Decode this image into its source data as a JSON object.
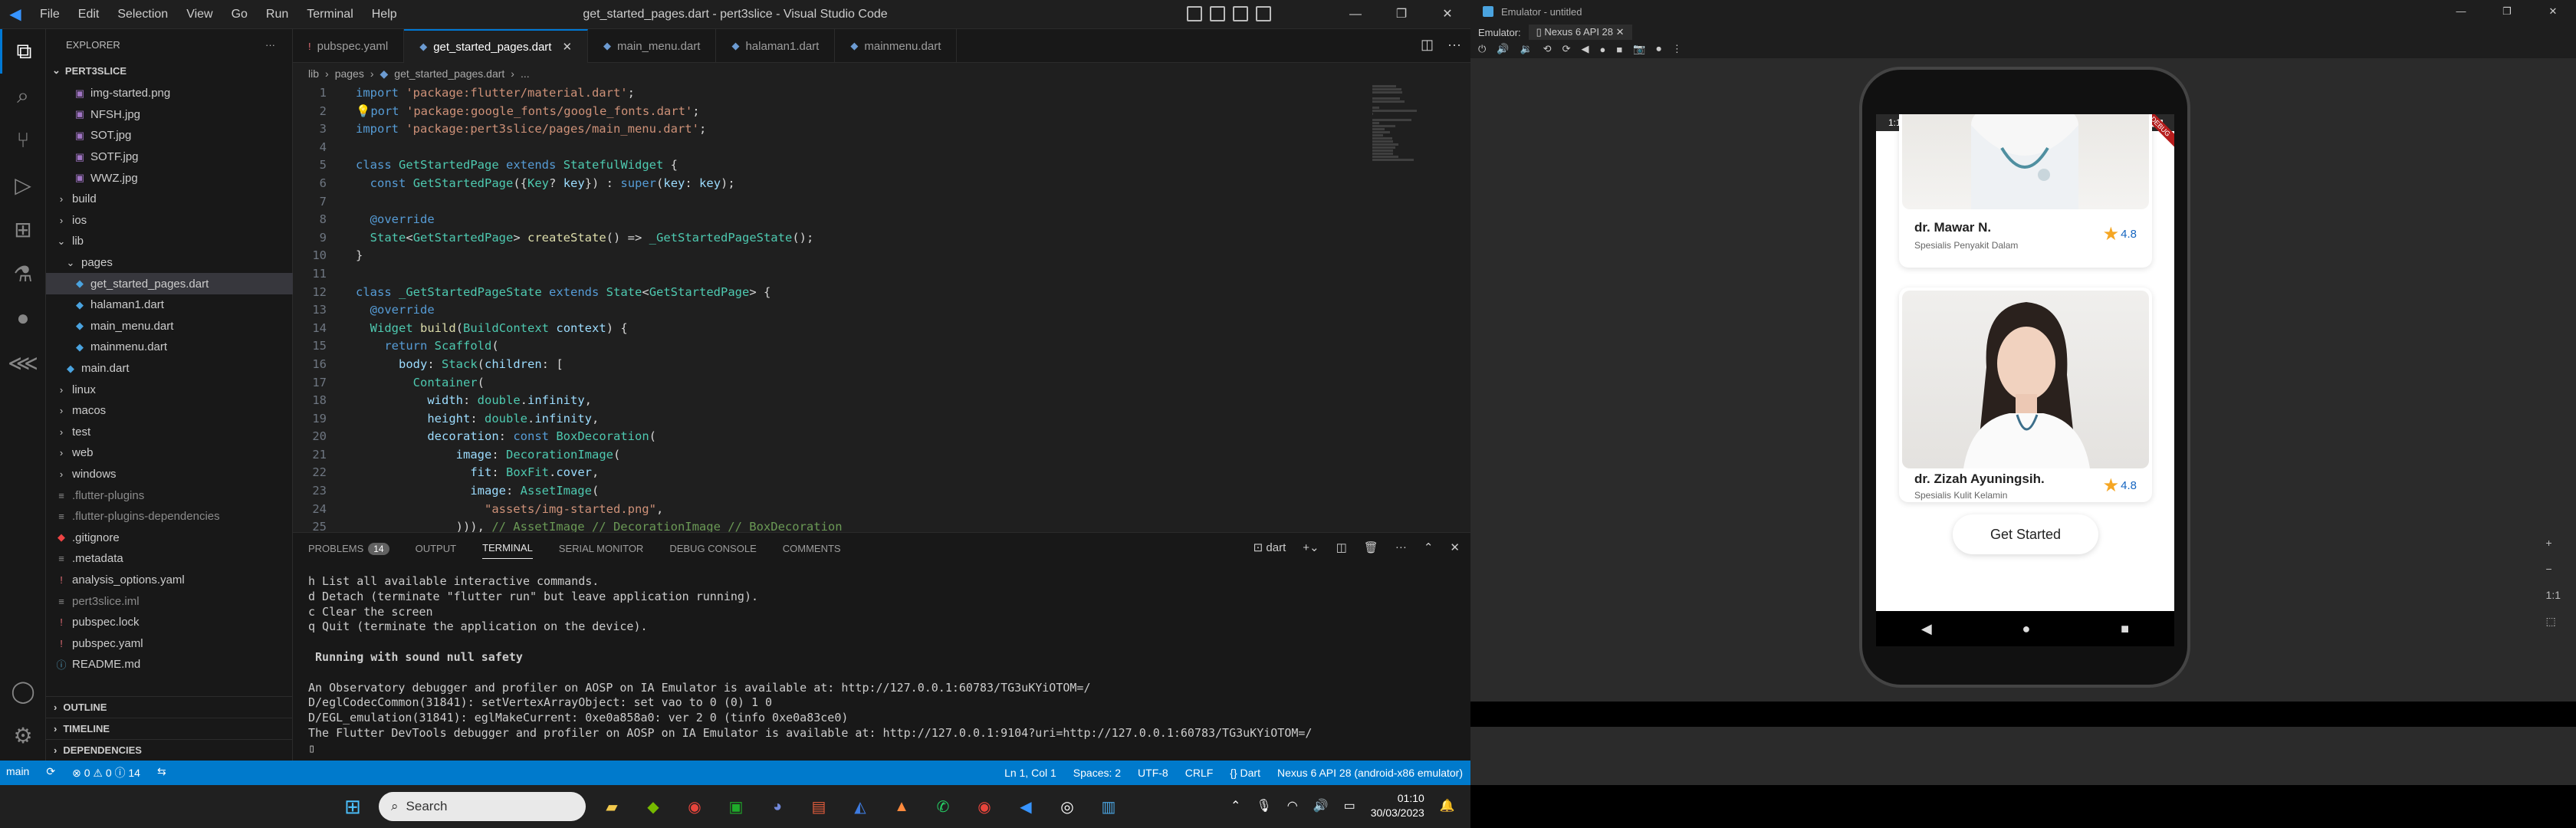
{
  "vscode": {
    "window_title": "get_started_pages.dart - pert3slice - Visual Studio Code",
    "menu": [
      "File",
      "Edit",
      "Selection",
      "View",
      "Go",
      "Run",
      "Terminal",
      "Help"
    ],
    "explorer_title": "EXPLORER",
    "project": "PERT3SLICE",
    "tree": [
      {
        "label": "img-started.png",
        "indent": 3,
        "icon": "image",
        "type": "file"
      },
      {
        "label": "NFSH.jpg",
        "indent": 3,
        "icon": "image",
        "type": "file"
      },
      {
        "label": "SOT.jpg",
        "indent": 3,
        "icon": "image",
        "type": "file"
      },
      {
        "label": "SOTF.jpg",
        "indent": 3,
        "icon": "image",
        "type": "file"
      },
      {
        "label": "WWZ.jpg",
        "indent": 3,
        "icon": "image",
        "type": "file"
      },
      {
        "label": "build",
        "indent": 1,
        "icon": "folder",
        "type": "folder"
      },
      {
        "label": "ios",
        "indent": 1,
        "icon": "folder",
        "type": "folder"
      },
      {
        "label": "lib",
        "indent": 1,
        "icon": "folder-open",
        "type": "folder"
      },
      {
        "label": "pages",
        "indent": 2,
        "icon": "folder-open",
        "type": "folder"
      },
      {
        "label": "get_started_pages.dart",
        "indent": 3,
        "icon": "dart",
        "type": "file",
        "selected": true
      },
      {
        "label": "halaman1.dart",
        "indent": 3,
        "icon": "dart",
        "type": "file"
      },
      {
        "label": "main_menu.dart",
        "indent": 3,
        "icon": "dart",
        "type": "file"
      },
      {
        "label": "mainmenu.dart",
        "indent": 3,
        "icon": "dart",
        "type": "file"
      },
      {
        "label": "main.dart",
        "indent": 2,
        "icon": "dart",
        "type": "file"
      },
      {
        "label": "linux",
        "indent": 1,
        "icon": "folder",
        "type": "folder"
      },
      {
        "label": "macos",
        "indent": 1,
        "icon": "folder",
        "type": "folder"
      },
      {
        "label": "test",
        "indent": 1,
        "icon": "folder",
        "type": "folder"
      },
      {
        "label": "web",
        "indent": 1,
        "icon": "folder",
        "type": "folder"
      },
      {
        "label": "windows",
        "indent": 1,
        "icon": "folder",
        "type": "folder"
      },
      {
        "label": ".flutter-plugins",
        "indent": 1,
        "icon": "file",
        "type": "file",
        "dim": true
      },
      {
        "label": ".flutter-plugins-dependencies",
        "indent": 1,
        "icon": "file",
        "type": "file",
        "dim": true
      },
      {
        "label": ".gitignore",
        "indent": 1,
        "icon": "git",
        "type": "file"
      },
      {
        "label": ".metadata",
        "indent": 1,
        "icon": "file",
        "type": "file"
      },
      {
        "label": "analysis_options.yaml",
        "indent": 1,
        "icon": "yaml",
        "type": "file"
      },
      {
        "label": "pert3slice.iml",
        "indent": 1,
        "icon": "file",
        "type": "file",
        "dim": true
      },
      {
        "label": "pubspec.lock",
        "indent": 1,
        "icon": "yaml",
        "type": "file"
      },
      {
        "label": "pubspec.yaml",
        "indent": 1,
        "icon": "yaml",
        "type": "file"
      },
      {
        "label": "README.md",
        "indent": 1,
        "icon": "info",
        "type": "file"
      }
    ],
    "sections": [
      "OUTLINE",
      "TIMELINE",
      "DEPENDENCIES"
    ],
    "tabs": [
      {
        "label": "pubspec.yaml",
        "active": false
      },
      {
        "label": "get_started_pages.dart",
        "active": true
      },
      {
        "label": "main_menu.dart",
        "active": false
      },
      {
        "label": "halaman1.dart",
        "active": false
      },
      {
        "label": "mainmenu.dart",
        "active": false
      }
    ],
    "breadcrumb": [
      "lib",
      "pages",
      "get_started_pages.dart",
      "..."
    ],
    "code_lines": [
      "<span class='kw'>import</span> <span class='st'>'package:flutter/material.dart'</span>;",
      "💡<span class='kw'>port</span> <span class='st'>'package:google_fonts/google_fonts.dart'</span>;",
      "<span class='kw'>import</span> <span class='st'>'package:pert3slice/pages/main_menu.dart'</span>;",
      "",
      "<span class='kw'>class</span> <span class='ty'>GetStartedPage</span> <span class='kw'>extends</span> <span class='ty'>StatefulWidget</span> {",
      "  <span class='kw'>const</span> <span class='ty'>GetStartedPage</span>({<span class='ty'>Key</span>? <span class='pa'>key</span>}) : <span class='kw'>super</span>(<span class='pa'>key</span>: <span class='pa'>key</span>);",
      "",
      "  <span class='an'>@override</span>",
      "  <span class='ty'>State</span>&lt;<span class='ty'>GetStartedPage</span>&gt; <span class='fn'>createState</span>() =&gt; <span class='ty'>_GetStartedPageState</span>();",
      "}",
      "",
      "<span class='kw'>class</span> <span class='ty'>_GetStartedPageState</span> <span class='kw'>extends</span> <span class='ty'>State</span>&lt;<span class='ty'>GetStartedPage</span>&gt; {",
      "  <span class='an'>@override</span>",
      "  <span class='ty'>Widget</span> <span class='fn'>build</span>(<span class='ty'>BuildContext</span> <span class='pa'>context</span>) {",
      "    <span class='kw'>return</span> <span class='ty'>Scaffold</span>(",
      "      <span class='pa'>body</span>: <span class='ty'>Stack</span>(<span class='pa'>children</span>: [",
      "        <span class='ty'>Container</span>(",
      "          <span class='pa'>width</span>: <span class='ty'>double</span>.<span class='pa'>infinity</span>,",
      "          <span class='pa'>height</span>: <span class='ty'>double</span>.<span class='pa'>infinity</span>,",
      "          <span class='pa'>decoration</span>: <span class='kw'>const</span> <span class='ty'>BoxDecoration</span>(",
      "              <span class='pa'>image</span>: <span class='ty'>DecorationImage</span>(",
      "                <span class='pa'>fit</span>: <span class='ty'>BoxFit</span>.<span class='pa'>cover</span>,",
      "                <span class='pa'>image</span>: <span class='ty'>AssetImage</span>(",
      "                  <span class='st'>\"assets/img-started.png\"</span>,",
      "              ))), <span class='cm'>// AssetImage // DecorationImage // BoxDecoration</span>"
    ],
    "panel_tabs": [
      {
        "label": "PROBLEMS",
        "badge": "14"
      },
      {
        "label": "OUTPUT"
      },
      {
        "label": "TERMINAL",
        "active": true
      },
      {
        "label": "SERIAL MONITOR"
      },
      {
        "label": "DEBUG CONSOLE"
      },
      {
        "label": "COMMENTS"
      }
    ],
    "terminal_name": "dart",
    "terminal_lines": [
      {
        "text": "h List all available interactive commands."
      },
      {
        "text": "d Detach (terminate \"flutter run\" but leave application running)."
      },
      {
        "text": "c Clear the screen"
      },
      {
        "text": "q Quit (terminate the application on the device)."
      },
      {
        "text": ""
      },
      {
        "text": " Running with sound null safety ",
        "bold": true
      },
      {
        "text": ""
      },
      {
        "text": "An Observatory debugger and profiler on AOSP on IA Emulator is available at: http://127.0.0.1:60783/TG3uKYiOTOM=/"
      },
      {
        "text": "D/eglCodecCommon(31841): setVertexArrayObject: set vao to 0 (0) 1 0"
      },
      {
        "text": "D/EGL_emulation(31841): eglMakeCurrent: 0xe0a858a0: ver 2 0 (tinfo 0xe0a83ce0)"
      },
      {
        "text": "The Flutter DevTools debugger and profiler on AOSP on IA Emulator is available at: http://127.0.0.1:9104?uri=http://127.0.0.1:60783/TG3uKYiOTOM=/"
      },
      {
        "text": "▯"
      }
    ],
    "status_left": [
      "main",
      "⟳",
      "⊗ 0 ⚠ 0 ⓘ 14",
      "⇆"
    ],
    "status_right": [
      "Ln 1, Col 1",
      "Spaces: 2",
      "UTF-8",
      "CRLF",
      "{} Dart",
      "Nexus 6 API 28 (android-x86 emulator)"
    ]
  },
  "emulator": {
    "title": "Emulator - untitled",
    "label": "Emulator:",
    "device_tab": "Nexus 6 API 28",
    "status_time": "1:10",
    "debug_banner": "DEBUG",
    "doctors": [
      {
        "name": "dr. Mawar N.",
        "specialty": "Spesialis Penyakit Dalam",
        "rating": "4.8"
      },
      {
        "name": "dr. Zizah Ayuningsih.",
        "specialty": "Spesialis Kulit Kelamin",
        "rating": "4.8"
      }
    ],
    "button": "Get Started"
  },
  "taskbar": {
    "search": "Search",
    "time": "01:10",
    "date": "30/03/2023"
  }
}
